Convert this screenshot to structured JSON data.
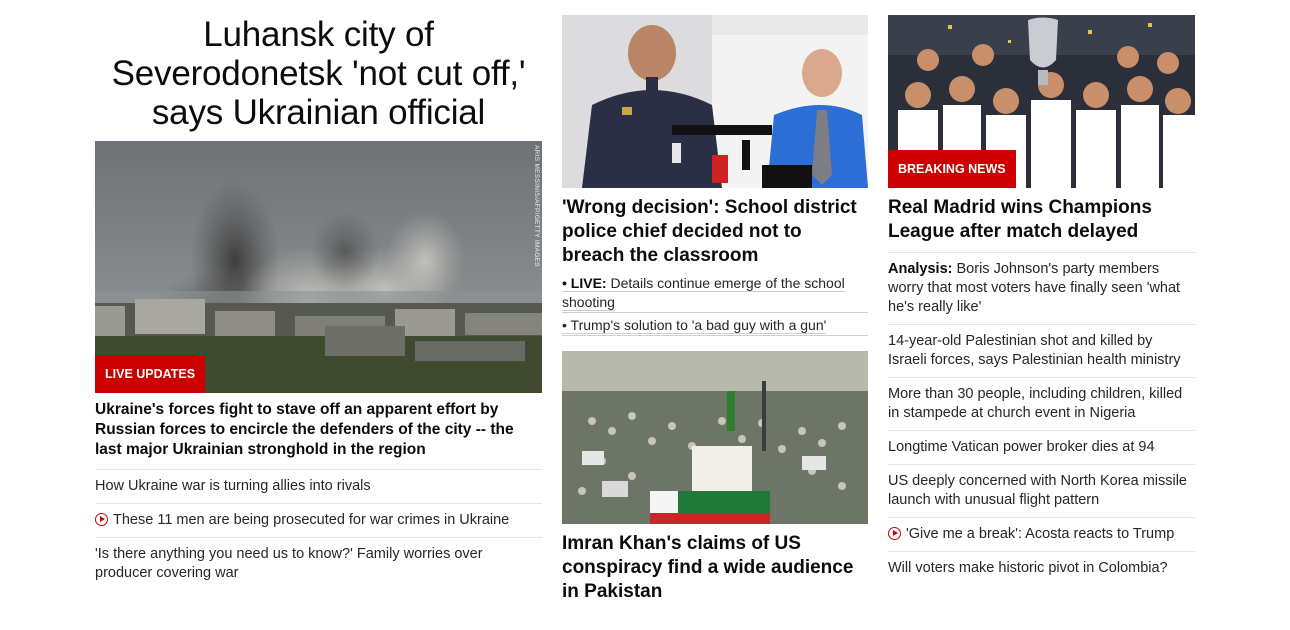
{
  "col1": {
    "title": "Luhansk city of Severodonetsk 'not cut off,' says Ukrainian official",
    "image_credit": "ARIS MESSINIS/AFP/GETTY IMAGES",
    "badge": "LIVE UPDATES",
    "headline": "Ukraine's forces fight to stave off an apparent effort by Russian forces to encircle the defenders of the city -- the last major Ukrainian stronghold in the region",
    "items": [
      {
        "text": "How Ukraine war is turning allies into rivals",
        "video": false
      },
      {
        "text": "These 11 men are being prosecuted for war crimes in Ukraine",
        "video": true
      },
      {
        "text": "'Is there anything you need us to know?' Family worries over producer covering war",
        "video": false
      }
    ]
  },
  "col2": {
    "story1": {
      "headline": "'Wrong decision': School district police chief decided not to breach the classroom",
      "sub1_kicker": "• LIVE:",
      "sub1_text": "Details continue emerge of the school shooting",
      "sub2_text": "• Trump's solution to 'a bad guy with a gun'"
    },
    "story2": {
      "headline": "Imran Khan's claims of US conspiracy find a wide audience in Pakistan"
    }
  },
  "col3": {
    "badge": "BREAKING NEWS",
    "headline": "Real Madrid wins Champions League after match delayed",
    "items": [
      {
        "kicker": "Analysis:",
        "text": "Boris Johnson's party members worry that most voters have finally seen 'what he's really like'",
        "video": false
      },
      {
        "kicker": "",
        "text": "14-year-old Palestinian shot and killed by Israeli forces, says Palestinian health ministry",
        "video": false
      },
      {
        "kicker": "",
        "text": "More than 30 people, including children, killed in stampede at church event in Nigeria",
        "video": false
      },
      {
        "kicker": "",
        "text": "Longtime Vatican power broker dies at 94",
        "video": false
      },
      {
        "kicker": "",
        "text": "US deeply concerned with North Korea missile launch with unusual flight pattern",
        "video": false
      },
      {
        "kicker": "",
        "text": "'Give me a break': Acosta reacts to Trump",
        "video": true
      },
      {
        "kicker": "",
        "text": "Will voters make historic pivot in Colombia?",
        "video": false
      }
    ]
  },
  "colors": {
    "accent": "#cc0000",
    "divider": "#e6e6e6"
  }
}
